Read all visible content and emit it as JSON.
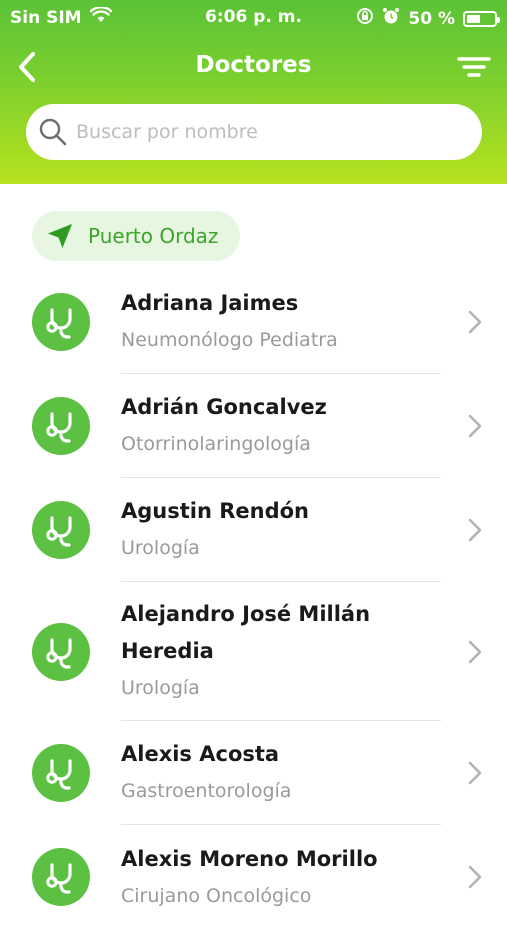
{
  "status_bar": {
    "carrier": "Sin SIM",
    "time": "6:06 p. m.",
    "battery_percent": "50 %",
    "battery_level": 0.5
  },
  "nav": {
    "title": "Doctores",
    "back_icon": "chevron-left-icon",
    "filter_icon": "filter-icon"
  },
  "search": {
    "placeholder": "Buscar por nombre",
    "value": ""
  },
  "location": {
    "label": "Puerto Ordaz",
    "icon": "location-arrow-icon"
  },
  "colors": {
    "brand_green": "#5bc236",
    "accent_lime": "#b7e21e",
    "chip_background": "#e6f6e1"
  },
  "doctors": [
    {
      "name": "Adriana Jaimes",
      "specialty": "Neumonólogo Pediatra"
    },
    {
      "name": "Adrián Goncalvez",
      "specialty": "Otorrinolaringología"
    },
    {
      "name": "Agustin Rendón",
      "specialty": "Urología"
    },
    {
      "name": "Alejandro José Millán Heredia",
      "specialty": "Urología"
    },
    {
      "name": "Alexis Acosta",
      "specialty": "Gastroentorología"
    },
    {
      "name": "Alexis Moreno Morillo",
      "specialty": "Cirujano Oncológico"
    }
  ]
}
